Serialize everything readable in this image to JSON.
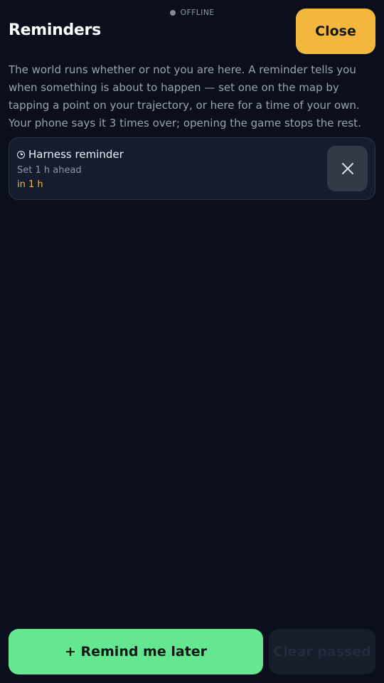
{
  "status": {
    "label": "OFFLINE"
  },
  "header": {
    "title": "Reminders",
    "close_label": "Close"
  },
  "intro": "The world runs whether or not you are here. A reminder tells you when something is about to happen — set one on the map by tapping a point on your trajectory, or here for a time of your own. Your phone says it 3 times over; opening the game stops the rest.",
  "reminders": [
    {
      "name": "Harness reminder",
      "detail": "Set 1 h ahead",
      "when": "in 1 h",
      "icon": "clock-icon",
      "delete_icon": "close-icon"
    }
  ],
  "footer": {
    "remind_label": "+ Remind me later",
    "clear_label": "Clear passed"
  },
  "colors": {
    "background": "#0a0f1b",
    "accent_orange": "#f4b73e",
    "accent_green": "#65e691",
    "card": "#141c2e"
  }
}
